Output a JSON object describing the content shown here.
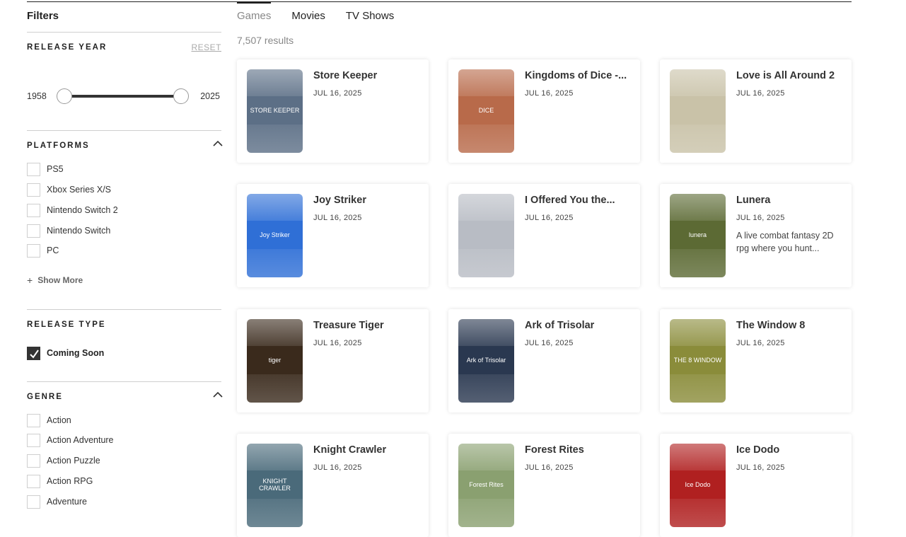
{
  "sidebar": {
    "title": "Filters",
    "release_year": {
      "title": "RELEASE YEAR",
      "reset": "RESET",
      "min": "1958",
      "max": "2025"
    },
    "platforms": {
      "title": "PLATFORMS",
      "items": [
        {
          "label": "PS5"
        },
        {
          "label": "Xbox Series X/S"
        },
        {
          "label": "Nintendo Switch 2"
        },
        {
          "label": "Nintendo Switch"
        },
        {
          "label": "PC"
        }
      ],
      "show_more": "Show More"
    },
    "release_type": {
      "title": "RELEASE TYPE",
      "items": [
        {
          "label": "Coming Soon",
          "checked": true
        }
      ]
    },
    "genre": {
      "title": "GENRE",
      "items": [
        {
          "label": "Action"
        },
        {
          "label": "Action Adventure"
        },
        {
          "label": "Action Puzzle"
        },
        {
          "label": "Action RPG"
        },
        {
          "label": "Adventure"
        }
      ]
    }
  },
  "tabs": [
    {
      "label": "Games",
      "active": true
    },
    {
      "label": "Movies"
    },
    {
      "label": "TV Shows"
    }
  ],
  "results": "7,507 results",
  "cards": [
    {
      "title": "Store Keeper",
      "date": "JUL 16, 2025",
      "thumb_text": "STORE KEEPER",
      "color": "#5c6f86"
    },
    {
      "title": "Kingdoms of Dice -...",
      "date": "JUL 16, 2025",
      "thumb_text": "DICE",
      "color": "#b86a4a"
    },
    {
      "title": "Love is All Around 2",
      "date": "JUL 16, 2025",
      "thumb_text": "",
      "color": "#c9c2a8"
    },
    {
      "title": "Joy Striker",
      "date": "JUL 16, 2025",
      "thumb_text": "Joy Striker",
      "color": "#2f6fd6"
    },
    {
      "title": "I Offered You the...",
      "date": "JUL 16, 2025",
      "thumb_text": "",
      "color": "#b8bcc4"
    },
    {
      "title": "Lunera",
      "date": "JUL 16, 2025",
      "description": "A live combat fantasy 2D rpg where you hunt...",
      "thumb_text": "lunera",
      "color": "#5c6a34"
    },
    {
      "title": "Treasure Tiger",
      "date": "JUL 16, 2025",
      "thumb_text": "tiger",
      "color": "#3a2a1c"
    },
    {
      "title": "Ark of Trisolar",
      "date": "JUL 16, 2025",
      "thumb_text": "Ark of Trisolar",
      "color": "#2a3850"
    },
    {
      "title": "The Window 8",
      "date": "JUL 16, 2025",
      "thumb_text": "THE 8 WINDOW",
      "color": "#8a8c3a"
    },
    {
      "title": "Knight Crawler",
      "date": "JUL 16, 2025",
      "thumb_text": "KNIGHT CRAWLER",
      "color": "#4a6a7a"
    },
    {
      "title": "Forest Rites",
      "date": "JUL 16, 2025",
      "thumb_text": "Forest Rites",
      "color": "#8aa070"
    },
    {
      "title": "Ice Dodo",
      "date": "JUL 16, 2025",
      "thumb_text": "Ice Dodo",
      "color": "#b02020"
    }
  ]
}
